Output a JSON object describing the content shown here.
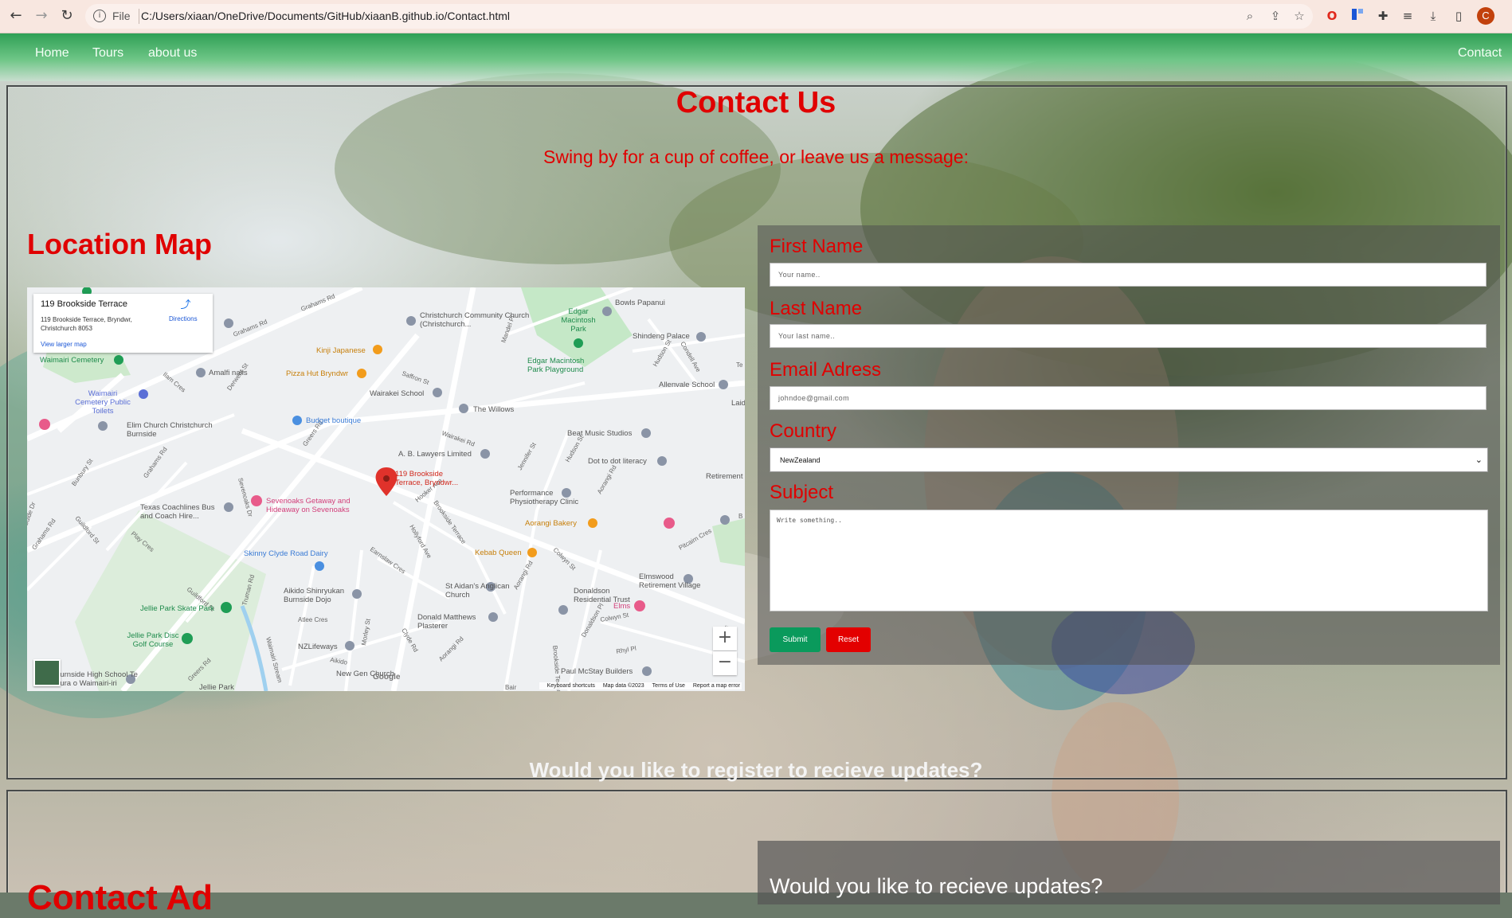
{
  "browser": {
    "url_scheme": "File",
    "url": "C:/Users/xiaan/OneDrive/Documents/GitHub/xiaanB.github.io/Contact.html",
    "profile_initial": "C"
  },
  "nav": {
    "home": "Home",
    "tours": "Tours",
    "about": "about us",
    "contact": "Contact"
  },
  "contact": {
    "title": "Contact Us",
    "subtitle": "Swing by for a cup of coffee, or leave us a message:"
  },
  "map": {
    "heading": "Location Map",
    "card_title": "119 Brookside Terrace",
    "card_address": "119 Brookside Terrace, Bryndwr, Christchurch 8053",
    "directions": "Directions",
    "larger_map": "View larger map",
    "pin_label": "119 Brookside Terrace, Bryndwr...",
    "zoom_in": "+",
    "zoom_out": "−",
    "google": "Google",
    "footer": {
      "shortcuts": "Keyboard shortcuts",
      "data": "Map data ©2023",
      "terms": "Terms of Use",
      "report": "Report a map error"
    },
    "places": [
      {
        "name": "Grahams Rd"
      },
      {
        "name": "Christchurch Community Church (Christchurch..."
      },
      {
        "name": "Edgar Macintosh Park"
      },
      {
        "name": "Bowls Papanui"
      },
      {
        "name": "Kinji Japanese"
      },
      {
        "name": "Shindeng Palace"
      },
      {
        "name": "Waimairi Cemetery"
      },
      {
        "name": "Amalfi nails"
      },
      {
        "name": "Pizza Hut Bryndwr"
      },
      {
        "name": "Edgar Macintosh Park Playground"
      },
      {
        "name": "Allenvale School"
      },
      {
        "name": "Waimairi Cemetery Public Toilets"
      },
      {
        "name": "Wairakei School"
      },
      {
        "name": "The Willows"
      },
      {
        "name": "Elim Church Christchurch Burnside"
      },
      {
        "name": "Budget boutique"
      },
      {
        "name": "Beat Music Studios"
      },
      {
        "name": "A. B. Lawyers Limited"
      },
      {
        "name": "Dot to dot literacy"
      },
      {
        "name": "Retirement"
      },
      {
        "name": "Sevenoaks Getaway and Hideaway on Sevenoaks"
      },
      {
        "name": "Performance Physiotherapy Clinic"
      },
      {
        "name": "Texas Coachlines Bus and Coach Hire..."
      },
      {
        "name": "Aorangi Bakery"
      },
      {
        "name": "Kebab Queen"
      },
      {
        "name": "Skinny Clyde Road Dairy"
      },
      {
        "name": "St Aidan's Anglican Church"
      },
      {
        "name": "Elmswood Retirement Village"
      },
      {
        "name": "Aikido Shinryukan Burnside Dojo"
      },
      {
        "name": "Donaldson Residential Trust"
      },
      {
        "name": "Jellie Park Skate Park"
      },
      {
        "name": "Donald Matthews Plasterer"
      },
      {
        "name": "Elms"
      },
      {
        "name": "Jellie Park Disc Golf Course"
      },
      {
        "name": "NZLifeways"
      },
      {
        "name": "Paul McStay Builders"
      },
      {
        "name": "Burnside High School Te Kura o Waimairi-iri"
      },
      {
        "name": "Jellie Park"
      },
      {
        "name": "New Gen Church"
      },
      {
        "name": "Waimairi Stream"
      },
      {
        "name": "Laid"
      }
    ]
  },
  "form": {
    "first_name_label": "First Name",
    "first_name_placeholder": "Your name..",
    "last_name_label": "Last Name",
    "last_name_placeholder": "Your last name..",
    "email_label": "Email Adress",
    "email_placeholder": "johndoe@gmail.com",
    "country_label": "Country",
    "country_value": "NewZealand",
    "subject_label": "Subject",
    "subject_placeholder": "Write something..",
    "submit": "Submit",
    "reset": "Reset",
    "submit_color": "#0a9a5c",
    "reset_color": "#e30000"
  },
  "register": {
    "title": "Would you like to register to recieve updates?",
    "panel_title": "Would you like to recieve updates?"
  },
  "address_heading": "Contact Ad",
  "accent": "#e00000"
}
